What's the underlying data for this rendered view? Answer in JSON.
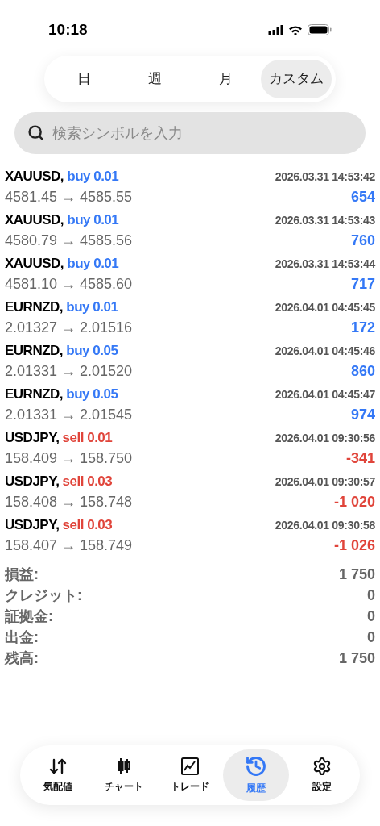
{
  "status_bar": {
    "time": "10:18"
  },
  "period_tabs": [
    {
      "label": "日",
      "selected": false
    },
    {
      "label": "週",
      "selected": false
    },
    {
      "label": "月",
      "selected": false
    },
    {
      "label": "カスタム",
      "selected": true
    }
  ],
  "search": {
    "placeholder": "検索シンボルを入力"
  },
  "trades": [
    {
      "symbol": "XAUUSD,",
      "kind": "buy",
      "order": "buy 0.01",
      "prices": "4581.45 → 4585.55",
      "time": "2026.03.31 14:53:42",
      "profit": "654"
    },
    {
      "symbol": "XAUUSD,",
      "kind": "buy",
      "order": "buy 0.01",
      "prices": "4580.79 → 4585.56",
      "time": "2026.03.31 14:53:43",
      "profit": "760"
    },
    {
      "symbol": "XAUUSD,",
      "kind": "buy",
      "order": "buy 0.01",
      "prices": "4581.10 → 4585.60",
      "time": "2026.03.31 14:53:44",
      "profit": "717"
    },
    {
      "symbol": "EURNZD,",
      "kind": "buy",
      "order": "buy 0.01",
      "prices": "2.01327 → 2.01516",
      "time": "2026.04.01 04:45:45",
      "profit": "172"
    },
    {
      "symbol": "EURNZD,",
      "kind": "buy",
      "order": "buy 0.05",
      "prices": "2.01331 → 2.01520",
      "time": "2026.04.01 04:45:46",
      "profit": "860"
    },
    {
      "symbol": "EURNZD,",
      "kind": "buy",
      "order": "buy 0.05",
      "prices": "2.01331 → 2.01545",
      "time": "2026.04.01 04:45:47",
      "profit": "974"
    },
    {
      "symbol": "USDJPY,",
      "kind": "sell",
      "order": "sell 0.01",
      "prices": "158.409 → 158.750",
      "time": "2026.04.01 09:30:56",
      "profit": "-341"
    },
    {
      "symbol": "USDJPY,",
      "kind": "sell",
      "order": "sell 0.03",
      "prices": "158.408 → 158.748",
      "time": "2026.04.01 09:30:57",
      "profit": "-1 020"
    },
    {
      "symbol": "USDJPY,",
      "kind": "sell",
      "order": "sell 0.03",
      "prices": "158.407 → 158.749",
      "time": "2026.04.01 09:30:58",
      "profit": "-1 026"
    }
  ],
  "summary": [
    {
      "label": "損益:",
      "value": "1 750"
    },
    {
      "label": "クレジット:",
      "value": "0"
    },
    {
      "label": "証拠金:",
      "value": "0"
    },
    {
      "label": "出金:",
      "value": "0"
    },
    {
      "label": "残高:",
      "value": "1 750"
    }
  ],
  "bottom_nav": [
    {
      "kind": "quotes",
      "label": "気配値",
      "selected": false
    },
    {
      "kind": "chart",
      "label": "チャート",
      "selected": false
    },
    {
      "kind": "trade",
      "label": "トレード",
      "selected": false
    },
    {
      "kind": "history",
      "label": "履歴",
      "selected": true
    },
    {
      "kind": "settings",
      "label": "設定",
      "selected": false
    }
  ]
}
